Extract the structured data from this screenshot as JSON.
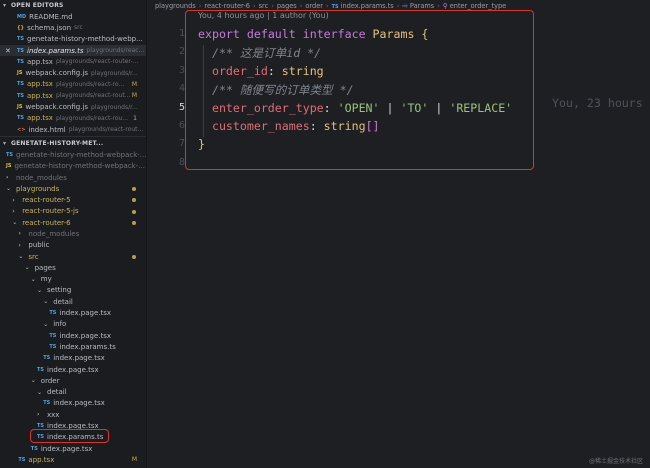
{
  "open_editors": {
    "header": "OPEN EDITORS",
    "items": [
      {
        "icon": "MD",
        "icon_type": "md",
        "name": "README.md",
        "path": ""
      },
      {
        "icon": "{}",
        "icon_type": "json",
        "name": "schema.json",
        "path": "src"
      },
      {
        "icon": "TS",
        "icon_type": "ts",
        "name": "genetate-history-method-webp...",
        "path": ""
      },
      {
        "icon": "TS",
        "icon_type": "ts",
        "name": "index.params.ts",
        "path": "playgrounds/reac...",
        "active": true
      },
      {
        "icon": "TS",
        "icon_type": "ts",
        "name": "app.tsx",
        "path": "playgrounds/react-router-..."
      },
      {
        "icon": "JS",
        "icon_type": "js",
        "name": "webpack.config.js",
        "path": "playgrounds/r..."
      },
      {
        "icon": "TS",
        "icon_type": "ts",
        "name": "app.tsx",
        "path": "playgrounds/react-ro...",
        "badge": "M",
        "modified": true
      },
      {
        "icon": "TS",
        "icon_type": "ts",
        "name": "app.tsx",
        "path": "playgrounds/react-rout...",
        "badge": "M",
        "modified": true
      },
      {
        "icon": "JS",
        "icon_type": "js",
        "name": "webpack.config.js",
        "path": "playgrounds/r..."
      },
      {
        "icon": "TS",
        "icon_type": "ts",
        "name": "app.tsx",
        "path": "playgrounds/react-rou...",
        "badge": "1",
        "modified": true
      },
      {
        "icon": "<>",
        "icon_type": "html",
        "name": "index.html",
        "path": "playgrounds/react-rout..."
      }
    ]
  },
  "project": {
    "header": "GENETATE-HISTORY-MET...",
    "items": [
      {
        "type": "file",
        "icon": "TS",
        "name": "genetate-history-method-webpack-...",
        "depth": 0,
        "dim": true
      },
      {
        "type": "file",
        "icon": "JS",
        "name": "genetate-history-method-webpack-...",
        "depth": 0,
        "dim": true
      },
      {
        "type": "folder",
        "open": false,
        "name": "node_modules",
        "depth": 0,
        "dim": true
      },
      {
        "type": "folder",
        "open": true,
        "name": "playgrounds",
        "depth": 0,
        "modified": true,
        "dot": true
      },
      {
        "type": "folder",
        "open": false,
        "name": "react-router-5",
        "depth": 1,
        "modified": true,
        "dot": true
      },
      {
        "type": "folder",
        "open": false,
        "name": "react-router-5-js",
        "depth": 1,
        "modified": true,
        "dot": true
      },
      {
        "type": "folder",
        "open": true,
        "name": "react-router-6",
        "depth": 1,
        "modified": true,
        "dot": true
      },
      {
        "type": "folder",
        "open": false,
        "name": "node_modules",
        "depth": 2,
        "dim": true
      },
      {
        "type": "folder",
        "open": false,
        "name": "public",
        "depth": 2
      },
      {
        "type": "folder",
        "open": true,
        "name": "src",
        "depth": 2,
        "modified": true,
        "dot": true
      },
      {
        "type": "folder",
        "open": true,
        "name": "pages",
        "depth": 3
      },
      {
        "type": "folder",
        "open": true,
        "name": "my",
        "depth": 4
      },
      {
        "type": "folder",
        "open": true,
        "name": "setting",
        "depth": 5
      },
      {
        "type": "folder",
        "open": true,
        "name": "detail",
        "depth": 6
      },
      {
        "type": "file",
        "icon": "TS",
        "name": "index.page.tsx",
        "depth": 7
      },
      {
        "type": "folder",
        "open": true,
        "name": "info",
        "depth": 6
      },
      {
        "type": "file",
        "icon": "TS",
        "name": "index.page.tsx",
        "depth": 7
      },
      {
        "type": "file",
        "icon": "TS",
        "name": "index.params.ts",
        "depth": 7
      },
      {
        "type": "file",
        "icon": "TS",
        "name": "index.page.tsx",
        "depth": 6
      },
      {
        "type": "file",
        "icon": "TS",
        "name": "index.page.tsx",
        "depth": 5
      },
      {
        "type": "folder",
        "open": true,
        "name": "order",
        "depth": 4
      },
      {
        "type": "folder",
        "open": true,
        "name": "detail",
        "depth": 5
      },
      {
        "type": "file",
        "icon": "TS",
        "name": "index.page.tsx",
        "depth": 6
      },
      {
        "type": "folder",
        "open": false,
        "name": "xxx",
        "depth": 5
      },
      {
        "type": "file",
        "icon": "TS",
        "name": "index.page.tsx",
        "depth": 5
      },
      {
        "type": "file",
        "icon": "TS",
        "name": "index.params.ts",
        "depth": 5,
        "selected": true
      },
      {
        "type": "file",
        "icon": "TS",
        "name": "index.page.tsx",
        "depth": 4
      },
      {
        "type": "file",
        "icon": "TS",
        "name": "app.tsx",
        "depth": 2,
        "badge": "M",
        "modified": true
      }
    ]
  },
  "breadcrumb": {
    "items": [
      "playgrounds",
      "react-router-6",
      "src",
      "pages",
      "order",
      "index.params.ts",
      "Params",
      "enter_order_type"
    ],
    "file_icon": "TS",
    "symbol_icon": "⇨",
    "field_icon": "⚲"
  },
  "editor": {
    "blame_header": "You, 4 hours ago | 1 author (You)",
    "current_line": 5,
    "inline_blame": "You, 23 hours",
    "lines": [
      {
        "num": "1",
        "tokens": [
          {
            "t": "export",
            "c": "kw"
          },
          {
            "t": " ",
            "c": "pu"
          },
          {
            "t": "default",
            "c": "kw"
          },
          {
            "t": " ",
            "c": "pu"
          },
          {
            "t": "interface",
            "c": "kw"
          },
          {
            "t": " ",
            "c": "pu"
          },
          {
            "t": "Params",
            "c": "ty"
          },
          {
            "t": " ",
            "c": "pu"
          },
          {
            "t": "{",
            "c": "bk"
          }
        ]
      },
      {
        "num": "2",
        "tokens": [
          {
            "t": "  ",
            "c": "pu"
          },
          {
            "t": "/** 这是订单id */",
            "c": "cm"
          }
        ]
      },
      {
        "num": "3",
        "tokens": [
          {
            "t": "  ",
            "c": "pu"
          },
          {
            "t": "order_id",
            "c": "pr"
          },
          {
            "t": ": ",
            "c": "pu"
          },
          {
            "t": "string",
            "c": "ty"
          }
        ]
      },
      {
        "num": "4",
        "tokens": [
          {
            "t": "  ",
            "c": "pu"
          },
          {
            "t": "/** 随便写的订单类型 */",
            "c": "cm"
          }
        ]
      },
      {
        "num": "5",
        "tokens": [
          {
            "t": "  ",
            "c": "pu"
          },
          {
            "t": "enter_order_type",
            "c": "pr"
          },
          {
            "t": ": ",
            "c": "pu"
          },
          {
            "t": "'OPEN'",
            "c": "st"
          },
          {
            "t": " | ",
            "c": "pu"
          },
          {
            "t": "'TO'",
            "c": "st"
          },
          {
            "t": " | ",
            "c": "pu"
          },
          {
            "t": "'REPLACE'",
            "c": "st"
          }
        ]
      },
      {
        "num": "6",
        "tokens": [
          {
            "t": "  ",
            "c": "pu"
          },
          {
            "t": "customer_names",
            "c": "pr"
          },
          {
            "t": ": ",
            "c": "pu"
          },
          {
            "t": "string",
            "c": "ty"
          },
          {
            "t": "[]",
            "c": "bk2"
          }
        ]
      },
      {
        "num": "7",
        "tokens": [
          {
            "t": "}",
            "c": "bk"
          }
        ]
      },
      {
        "num": "8",
        "tokens": []
      }
    ]
  },
  "watermark": "@稀土掘金技术社区"
}
